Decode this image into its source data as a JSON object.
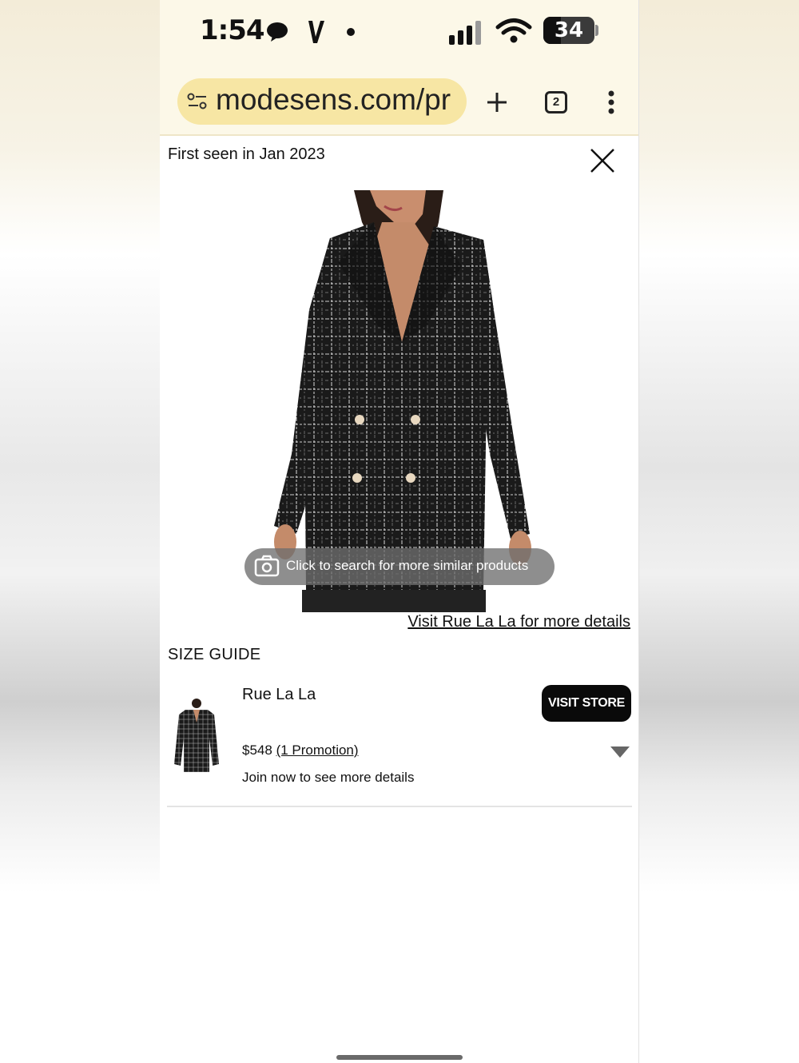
{
  "status_bar": {
    "time": "1:54",
    "battery": "34",
    "icons": [
      "chat-bubble-icon",
      "v-app-icon",
      "dot-icon",
      "signal-icon",
      "wifi-icon",
      "battery-icon"
    ]
  },
  "browser": {
    "url": "modesens.com/pr",
    "tab_count": "2",
    "icons": [
      "site-settings-icon",
      "new-tab-plus-icon",
      "tab-switcher-icon",
      "more-menu-icon"
    ]
  },
  "panel": {
    "first_seen": "First seen in Jan 2023",
    "search_similar": "Click to search for more similar products",
    "visit_link": "Visit Rue La La for more details",
    "size_guide": "SIZE GUIDE"
  },
  "store": {
    "name": "Rue La La",
    "visit_button": "VISIT STORE",
    "price": "$548",
    "promotion": "(1 Promotion)",
    "join_text": "Join now to see more details"
  },
  "colors": {
    "browser_bar": "#fcf8e8",
    "url_pill": "#f7e6a4",
    "button_dark": "#0a0a0a"
  }
}
